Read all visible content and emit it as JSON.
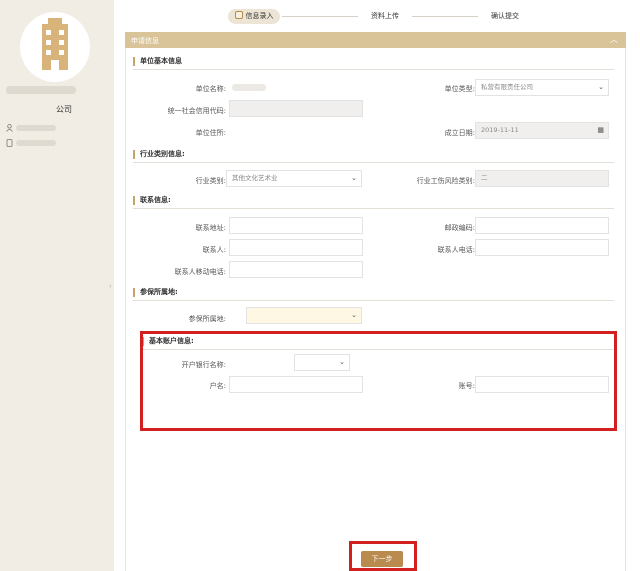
{
  "sidebar": {
    "company_suffix": "公司"
  },
  "steps": [
    {
      "label": "信息录入"
    },
    {
      "label": "资料上传"
    },
    {
      "label": "确认提交"
    }
  ],
  "panel": {
    "title": "申请信息",
    "toggle_icon": "chevron-up"
  },
  "sections": {
    "basic": "单位基本信息",
    "industry": "行业类别信息:",
    "contact": "联系信息:",
    "insured": "参保所属地:",
    "bank": "基本账户信息:"
  },
  "basic": {
    "name_label": "单位名称:",
    "type_label": "单位类型:",
    "type_value": "私营有限责任公司",
    "credit_code_label": "统一社会信用代码:",
    "address_label": "单位住所:",
    "founded_label": "成立日期:",
    "founded_value": "2019-11-11"
  },
  "industry": {
    "category_label": "行业类别:",
    "category_value": "其他文化艺术业",
    "risk_label": "行业工伤风险类别:",
    "risk_value": "二"
  },
  "contact": {
    "address_label": "联系地址:",
    "postcode_label": "邮政编码:",
    "person_label": "联系人:",
    "phone_label": "联系人电话:",
    "mobile_label": "联系人移动电话:"
  },
  "insured": {
    "location_label": "参保所属地:"
  },
  "bank": {
    "bank_name_label": "开户银行名称:",
    "account_name_label": "户名:",
    "account_no_label": "账号:"
  },
  "next_button": "下一步"
}
